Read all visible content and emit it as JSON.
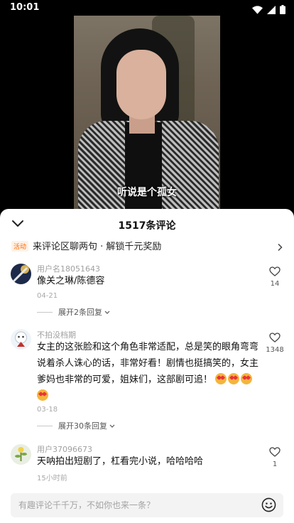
{
  "status_bar": {
    "time": "10:01"
  },
  "video": {
    "subtitle": "听说是个孤女"
  },
  "comments_panel": {
    "title": "1517条评论",
    "promo": {
      "badge": "活动",
      "text": "来评论区聊两句 · 解锁千元奖励"
    },
    "comments": [
      {
        "user": "用户名18051643",
        "text": "像关之琳/陈德容",
        "date": "04-21",
        "expand": "展开2条回复",
        "likes": "14"
      },
      {
        "user": "不拍没档期",
        "text": "女主的这张脸和这个角色非常适配，总是笑的眼角弯弯说着杀人诛心的话，非常好看！剧情也挺搞笑的，女主爹妈也非常的可爱，姐妹们，这部剧可追！",
        "date": "03-18",
        "expand": "展开30条回复",
        "likes": "1348"
      },
      {
        "user": "用户37096673",
        "text": "天呐拍出短剧了，杠看完小说，哈哈哈哈",
        "date": "15小时前",
        "likes": "1"
      }
    ],
    "input": {
      "placeholder": "有趣评论千千万，不如你也来一条？"
    }
  },
  "icons": {
    "collapse": "chevron-down-icon",
    "promo_arrow": "chevron-right-icon",
    "like": "heart-outline-icon",
    "expand_arrow": "chevron-down-small-icon",
    "emoji": "smiley-icon",
    "wifi": "wifi-icon",
    "signal": "signal-icon",
    "battery": "battery-icon"
  },
  "colors": {
    "promo_accent": "#ff6a00",
    "sheet_bg": "#ffffff",
    "input_bg": "#f3f3f3"
  }
}
